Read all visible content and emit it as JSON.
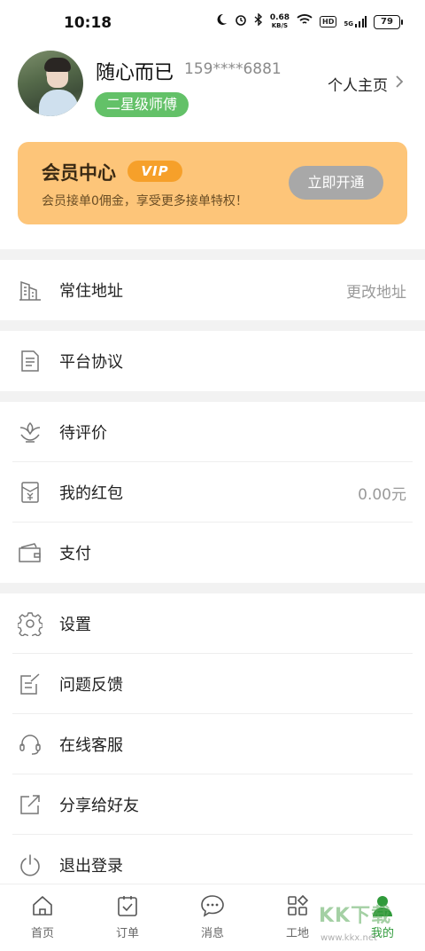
{
  "status_bar": {
    "time": "10:18",
    "net_speed_value": "0.68",
    "net_speed_unit": "KB/S",
    "hd": "HD",
    "signal": "5G",
    "battery": "79"
  },
  "profile": {
    "name": "随心而已",
    "phone": "159****6881",
    "level": "二星级师傅",
    "homepage_label": "个人主页"
  },
  "vip": {
    "title": "会员中心",
    "badge": "VIP",
    "desc": "会员接单0佣金，享受更多接单特权！",
    "button": "立即开通"
  },
  "menu": {
    "address": {
      "label": "常住地址",
      "value": "更改地址",
      "icon": "building-icon"
    },
    "agreement": {
      "label": "平台协议",
      "icon": "document-icon"
    },
    "review": {
      "label": "待评价",
      "icon": "flower-icon"
    },
    "redpacket": {
      "label": "我的红包",
      "value": "0.00元",
      "icon": "red-envelope-icon"
    },
    "payment": {
      "label": "支付",
      "icon": "wallet-icon"
    },
    "settings": {
      "label": "设置",
      "icon": "gear-icon"
    },
    "feedback": {
      "label": "问题反馈",
      "icon": "edit-note-icon"
    },
    "service": {
      "label": "在线客服",
      "icon": "headset-icon"
    },
    "share": {
      "label": "分享给好友",
      "icon": "share-icon"
    },
    "logout": {
      "label": "退出登录",
      "icon": "power-icon"
    }
  },
  "nav": {
    "items": [
      {
        "label": "首页",
        "icon": "home-icon"
      },
      {
        "label": "订单",
        "icon": "clipboard-icon"
      },
      {
        "label": "消息",
        "icon": "chat-icon"
      },
      {
        "label": "工地",
        "icon": "grid-icon"
      },
      {
        "label": "我的",
        "icon": "user-icon",
        "active": true
      }
    ]
  },
  "watermark": {
    "text": "KK下载",
    "url": "www.kkx.net"
  },
  "colors": {
    "accent_green": "#63c168",
    "vip_bg": "#fdc579",
    "vip_badge": "#f6a02a",
    "active_nav": "#2f9a3a"
  }
}
